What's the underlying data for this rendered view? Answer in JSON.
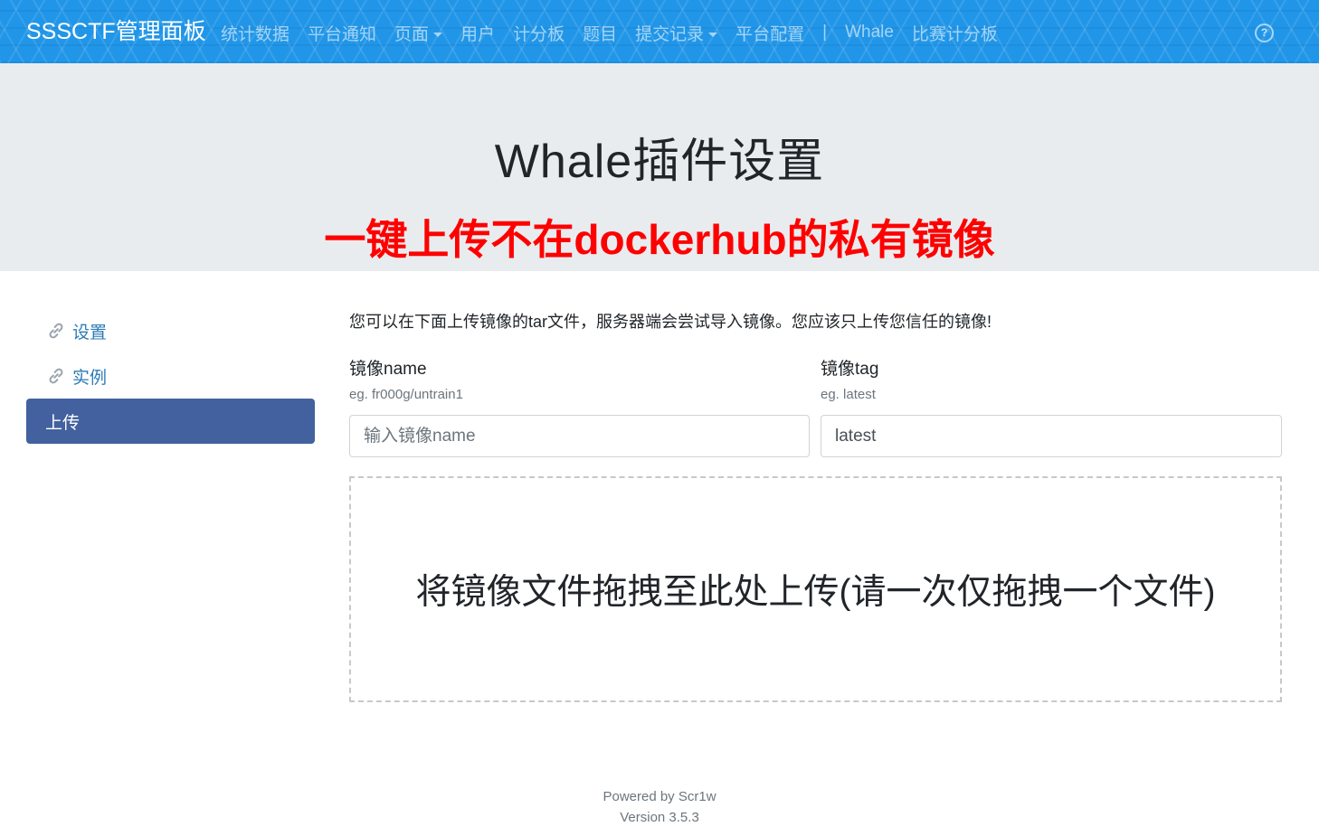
{
  "navbar": {
    "brand": "SSSCTF管理面板",
    "items": [
      {
        "label": "统计数据",
        "dropdown": false
      },
      {
        "label": "平台通知",
        "dropdown": false
      },
      {
        "label": "页面",
        "dropdown": true
      },
      {
        "label": "用户",
        "dropdown": false
      },
      {
        "label": "计分板",
        "dropdown": false
      },
      {
        "label": "题目",
        "dropdown": false
      },
      {
        "label": "提交记录",
        "dropdown": true
      },
      {
        "label": "平台配置",
        "dropdown": false
      }
    ],
    "separator": "|",
    "items_after": [
      {
        "label": "Whale"
      },
      {
        "label": "比赛计分板"
      }
    ],
    "help_icon": "question-circle-icon",
    "help_glyph": "?"
  },
  "header": {
    "title": "Whale插件设置",
    "subtitle": "一键上传不在dockerhub的私有镜像"
  },
  "sidebar": {
    "items": [
      {
        "label": "设置",
        "icon": "link-icon",
        "active": false
      },
      {
        "label": "实例",
        "icon": "link-icon",
        "active": false
      },
      {
        "label": "上传",
        "icon": "",
        "active": true
      }
    ]
  },
  "upload": {
    "intro": "您可以在下面上传镜像的tar文件，服务器端会尝试导入镜像。您应该只上传您信任的镜像!",
    "name_label": "镜像name",
    "name_help": "eg. fr000g/untrain1",
    "name_placeholder": "输入镜像name",
    "name_value": "",
    "tag_label": "镜像tag",
    "tag_help": "eg. latest",
    "tag_value": "latest",
    "dropzone_text": "将镜像文件拖拽至此处上传(请一次仅拖拽一个文件)"
  },
  "footer": {
    "powered": "Powered by Scr1w",
    "version": "Version 3.5.3"
  },
  "colors": {
    "navbar_bg": "#2196e8",
    "jumbotron_bg": "#e9ecef",
    "subtitle_red": "#ff0000",
    "sidebar_active": "#42619e",
    "link_blue": "#2c7bb6"
  }
}
